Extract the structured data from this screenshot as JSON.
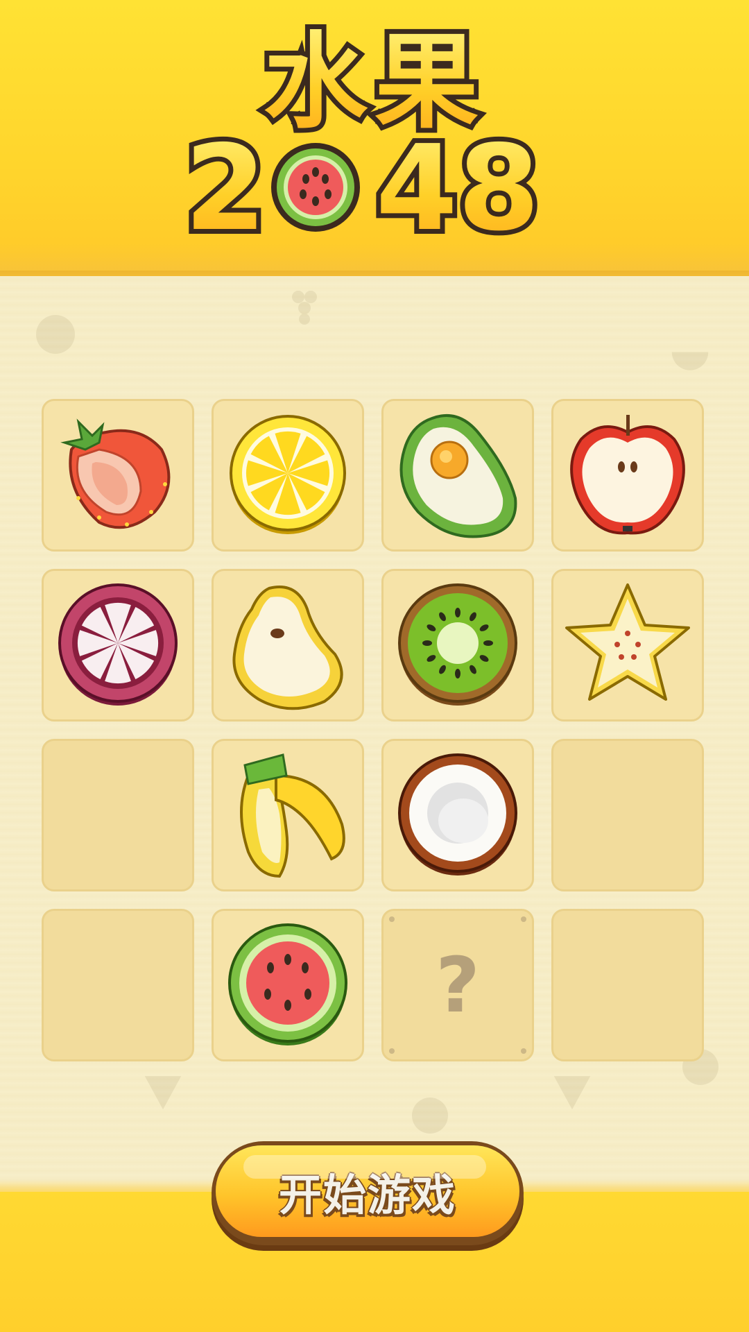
{
  "title": {
    "line1": "水果",
    "line2_left": "2",
    "line2_right": "48",
    "logo_icon": "watermelon-icon"
  },
  "board": {
    "rows": 4,
    "cols": 4,
    "tiles": [
      [
        "strawberry",
        "lemon",
        "avocado",
        "apple"
      ],
      [
        "mangosteen",
        "pear",
        "kiwi",
        "starfruit"
      ],
      [
        "empty",
        "banana",
        "coconut",
        "empty"
      ],
      [
        "empty",
        "watermelon",
        "locked",
        "empty"
      ]
    ],
    "locked_symbol": "?"
  },
  "start_button": {
    "label": "开始游戏"
  },
  "colors": {
    "header": "#ffd52c",
    "board_bg": "#f6edc4",
    "tile": "#f6e3a8",
    "tile_border": "#ead18b",
    "button_top": "#ffe65a",
    "button_bottom": "#ff9a1e",
    "outline": "#3b2a1e"
  }
}
